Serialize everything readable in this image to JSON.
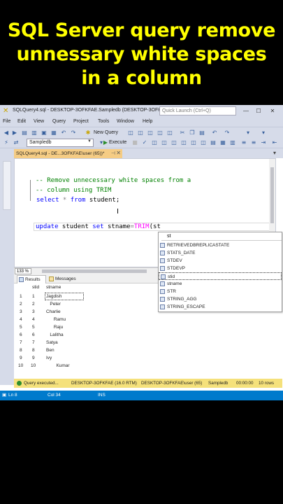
{
  "banner": {
    "line1": "SQL Server query remove",
    "line2": "unnessary white spaces",
    "line3": "in a column"
  },
  "window": {
    "title": "SQLQuery4.sql - DESKTOP-3OFKFAE.Sampledb (DESKTOP-3OFK",
    "quick_launch_placeholder": "Quick Launch (Ctrl+Q)"
  },
  "menu": [
    "File",
    "Edit",
    "View",
    "Query",
    "Project",
    "Tools",
    "Window",
    "Help"
  ],
  "toolbar": {
    "new_query": "New Query",
    "database": "Sampledb",
    "execute": "Execute"
  },
  "editor_tab": {
    "label": "SQLQuery4.sql - DE...3OFKFAE\\user (65))*"
  },
  "code": {
    "comment1": "-- Remove unnecessary white spaces from a",
    "comment2": "-- column using TRIM",
    "select_kw": "select",
    "select_star": " * ",
    "from_kw": "from",
    "select_table": " student;",
    "update_kw": "update",
    "update_rest": " student ",
    "set_kw": "set",
    "set_col": " stname",
    "eq": "=",
    "trim_fn": "TRIM",
    "trim_arg": "(st"
  },
  "intellisense": {
    "typed": "st",
    "items": [
      "RETRIEVEDBREPLICASTATE",
      "STATS_DATE",
      "STDEV",
      "STDEVP",
      "stid",
      "stname",
      "STR",
      "STRING_AGG",
      "STRING_ESCAPE"
    ],
    "selected_index": 4
  },
  "zoom": "133 %",
  "results_tabs": {
    "results": "Results",
    "messages": "Messages"
  },
  "grid": {
    "columns": [
      "stid",
      "stname"
    ],
    "rows": [
      {
        "n": "1",
        "stid": "1",
        "stname": "Jagdish"
      },
      {
        "n": "2",
        "stid": "2",
        "stname": "   Peter"
      },
      {
        "n": "3",
        "stid": "3",
        "stname": "Charlie"
      },
      {
        "n": "4",
        "stid": "4",
        "stname": "      Ramu"
      },
      {
        "n": "5",
        "stid": "5",
        "stname": "      Raju"
      },
      {
        "n": "6",
        "stid": "6",
        "stname": "   Lalitha"
      },
      {
        "n": "7",
        "stid": "7",
        "stname": "Satya"
      },
      {
        "n": "8",
        "stid": "8",
        "stname": "Ben"
      },
      {
        "n": "9",
        "stid": "9",
        "stname": "Ivy"
      },
      {
        "n": "10",
        "stid": "10",
        "stname": "        Kumar"
      }
    ]
  },
  "query_status": {
    "message": "Query executed...",
    "server": "DESKTOP-3OFKFAE (16.0 RTM)",
    "user": "DESKTOP-3OFKFAE\\user (65)",
    "db": "Sampledb",
    "time": "00:00:00",
    "rows": "10 rows"
  },
  "statusbar": {
    "ln": "Ln 8",
    "col": "Col 34",
    "ins": "INS"
  },
  "colors": {
    "banner_text": "#ffff00",
    "status_blue": "#007acc",
    "query_status_bg": "#f5e17b",
    "tab_active": "#f5cc84"
  }
}
